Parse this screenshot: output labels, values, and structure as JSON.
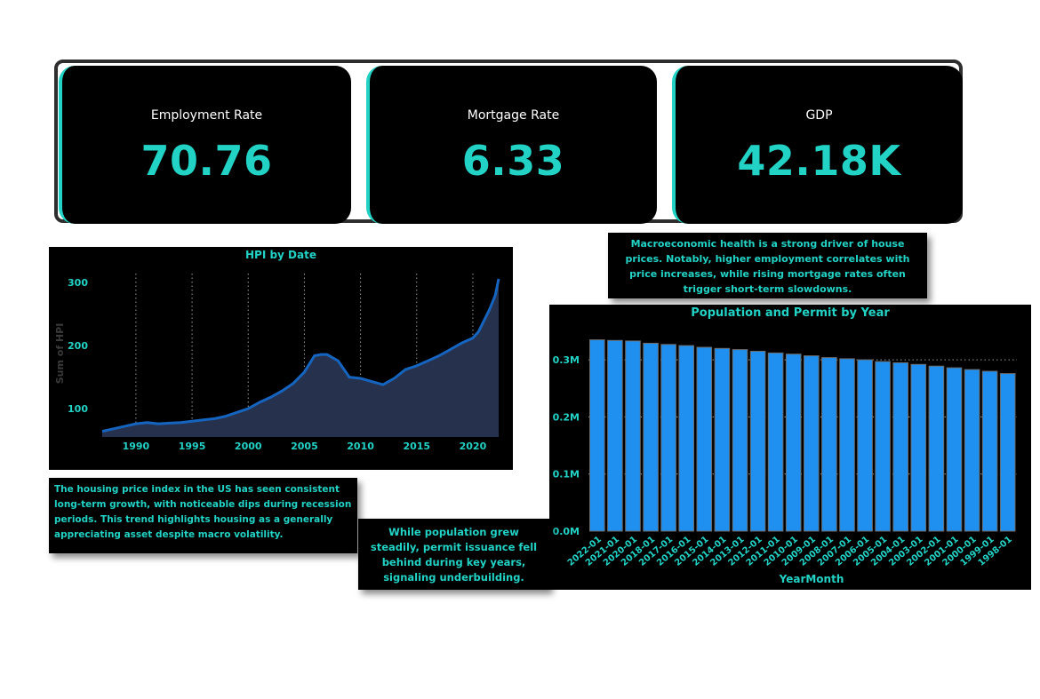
{
  "kpis": [
    {
      "label": "Employment Rate",
      "value": "70.76"
    },
    {
      "label": "Mortgage Rate",
      "value": "6.33"
    },
    {
      "label": "GDP",
      "value": "42.18K"
    }
  ],
  "notes": {
    "macro": "Macroeconomic health is a strong driver of house prices. Notably, higher employment correlates with price increases, while rising mortgage rates often trigger short-term slowdowns.",
    "hpi": "The housing price index in the US has seen consistent long-term growth, with noticeable dips during recession periods. This trend highlights housing as a generally appreciating asset despite macro volatility.",
    "population": "While population grew steadily, permit issuance fell behind during key years, signaling underbuilding."
  },
  "colors": {
    "accent": "#22d3c5",
    "bar": "#1f8ff0",
    "line": "#1565c0",
    "area": "#26324d"
  },
  "chart_data": [
    {
      "type": "area",
      "title": "HPI by Date",
      "xlabel": "",
      "ylabel": "Sum of HPI",
      "xlim": [
        1987,
        2022.3
      ],
      "ylim": [
        55,
        320
      ],
      "xticks": [
        1990,
        1995,
        2000,
        2005,
        2010,
        2015,
        2020
      ],
      "yticks": [
        100,
        200,
        300
      ],
      "grid": "vertical-dotted",
      "x": [
        1987,
        1988,
        1989,
        1990,
        1991,
        1992,
        1993,
        1994,
        1995,
        1996,
        1997,
        1998,
        1999,
        2000,
        2001,
        2002,
        2003,
        2004,
        2005,
        2005.9,
        2006.5,
        2007,
        2008,
        2009,
        2010,
        2011,
        2012,
        2013,
        2014,
        2015,
        2016,
        2017,
        2018,
        2019,
        2020,
        2020.5,
        2021,
        2021.5,
        2022,
        2022.3
      ],
      "values": [
        64,
        68,
        72,
        76,
        78,
        76,
        77,
        78,
        80,
        82,
        84,
        88,
        94,
        100,
        110,
        118,
        128,
        140,
        158,
        184,
        186,
        186,
        176,
        150,
        148,
        143,
        138,
        148,
        162,
        168,
        176,
        184,
        194,
        204,
        212,
        222,
        240,
        258,
        280,
        306
      ]
    },
    {
      "type": "bar",
      "title": "Population and Permit by Year",
      "xlabel": "YearMonth",
      "ylabel": "",
      "ylim": [
        0,
        0.35
      ],
      "yunit": "M",
      "yticks": [
        "0.0M",
        "0.1M",
        "0.2M",
        "0.3M"
      ],
      "grid": "horizontal-dotted",
      "categories": [
        "2022-01",
        "2021-01",
        "2020-01",
        "2018-01",
        "2017-01",
        "2016-01",
        "2015-01",
        "2014-01",
        "2013-01",
        "2012-01",
        "2011-01",
        "2010-01",
        "2009-01",
        "2008-01",
        "2007-01",
        "2006-01",
        "2005-01",
        "2004-01",
        "2003-01",
        "2002-01",
        "2001-01",
        "2000-01",
        "1999-01",
        "1998-01"
      ],
      "values": [
        0.335,
        0.334,
        0.333,
        0.329,
        0.327,
        0.325,
        0.322,
        0.32,
        0.318,
        0.315,
        0.312,
        0.31,
        0.307,
        0.304,
        0.302,
        0.3,
        0.297,
        0.295,
        0.292,
        0.289,
        0.286,
        0.283,
        0.28,
        0.276
      ]
    }
  ]
}
